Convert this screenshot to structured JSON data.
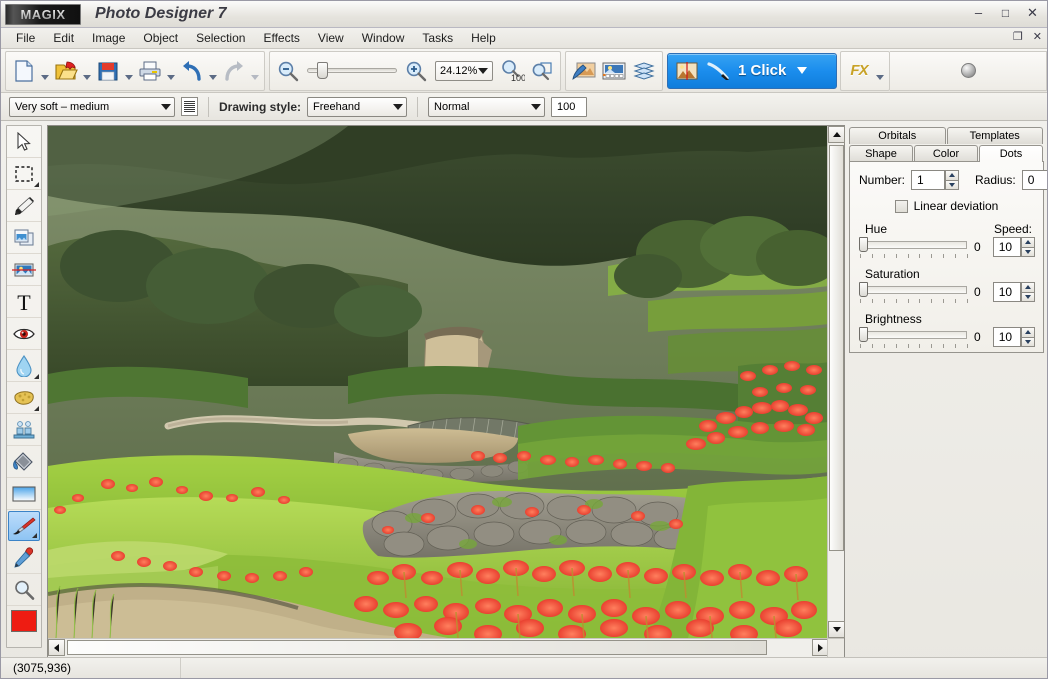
{
  "window": {
    "brand": "MAGIX",
    "title": "Photo Designer 7",
    "minimize_label": "–",
    "maximize_label": "□",
    "close_label": "✕",
    "doc_restore_label": "❐",
    "doc_close_label": "✕"
  },
  "menu": {
    "items": [
      {
        "label": "File"
      },
      {
        "label": "Edit"
      },
      {
        "label": "Image"
      },
      {
        "label": "Object"
      },
      {
        "label": "Selection"
      },
      {
        "label": "Effects"
      },
      {
        "label": "View"
      },
      {
        "label": "Window"
      },
      {
        "label": "Tasks"
      },
      {
        "label": "Help"
      }
    ]
  },
  "toolbar": {
    "file_group": [
      {
        "name": "new-document",
        "icon": "page-icon",
        "has_caret": true,
        "enabled": true
      },
      {
        "name": "open-document",
        "icon": "folder-open-icon",
        "has_caret": true,
        "enabled": true
      },
      {
        "name": "save-document",
        "icon": "floppy-disk-icon",
        "has_caret": true,
        "enabled": true
      },
      {
        "name": "print-document",
        "icon": "printer-icon",
        "has_caret": true,
        "enabled": true
      },
      {
        "name": "undo",
        "icon": "undo-arrow-icon",
        "has_caret": true,
        "enabled": true
      },
      {
        "name": "redo",
        "icon": "redo-arrow-icon",
        "has_caret": true,
        "enabled": false
      }
    ],
    "zoom_out_label": "Zoom out",
    "zoom_in_label": "Zoom in",
    "zoom_value": "24.12%",
    "zoom_100_label": "100",
    "zoom_fit_label": "Fit to window",
    "view_group": [
      {
        "name": "edit-mode",
        "icon": "brush-photo-icon"
      },
      {
        "name": "media-pool",
        "icon": "filmstrip-icon"
      },
      {
        "name": "layers",
        "icon": "layers-stack-icon"
      }
    ],
    "one_click_label": "1 Click",
    "fx_label": "FX",
    "help_icon_name": "globe-icon"
  },
  "options_bar": {
    "brush_preset": "Very soft – medium",
    "preset_list_icon": "list-view-icon",
    "drawing_style_label": "Drawing style:",
    "drawing_style_value": "Freehand",
    "blend_mode_value": "Normal",
    "opacity_value": "100"
  },
  "tools": [
    {
      "name": "tool-pointer",
      "icon": "arrow-cursor-icon",
      "corner": false,
      "active": false
    },
    {
      "name": "tool-select",
      "icon": "marquee-select-icon",
      "corner": true,
      "active": false
    },
    {
      "name": "tool-pencil",
      "icon": "pencil-icon",
      "corner": false,
      "active": false
    },
    {
      "name": "tool-clone",
      "icon": "clone-stamp-icon",
      "corner": false,
      "active": false
    },
    {
      "name": "tool-crop",
      "icon": "crop-image-icon",
      "corner": false,
      "active": false
    },
    {
      "name": "tool-text",
      "icon": "text-icon",
      "corner": false,
      "active": false
    },
    {
      "name": "tool-redeye",
      "icon": "red-eye-icon",
      "corner": false,
      "active": false
    },
    {
      "name": "tool-blur",
      "icon": "water-drop-icon",
      "corner": true,
      "active": false
    },
    {
      "name": "tool-sponge",
      "icon": "sponge-icon",
      "corner": true,
      "active": false
    },
    {
      "name": "tool-clone-figures",
      "icon": "figures-icon",
      "corner": false,
      "active": false
    },
    {
      "name": "tool-fill",
      "icon": "paint-bucket-icon",
      "corner": false,
      "active": false
    },
    {
      "name": "tool-gradient",
      "icon": "gradient-icon",
      "corner": false,
      "active": false
    },
    {
      "name": "tool-brush",
      "icon": "paint-brush-icon",
      "corner": true,
      "active": true
    },
    {
      "name": "tool-eyedropper",
      "icon": "eyedropper-icon",
      "corner": false,
      "active": false
    },
    {
      "name": "tool-zoom",
      "icon": "magnifier-icon",
      "corner": false,
      "active": false
    }
  ],
  "foreground_color": "#ee1c12",
  "canvas": {
    "image_description": "Japanese terraced rice fields in late summer with clusters of red spider lilies along stone retaining walls and footpaths, forested hillside behind",
    "scroll_vertical_name": "canvas-vertical-scrollbar",
    "scroll_horizontal_name": "canvas-horizontal-scrollbar"
  },
  "panel": {
    "tabs_top": [
      {
        "label": "Orbitals",
        "active": false
      },
      {
        "label": "Templates",
        "active": false
      }
    ],
    "tabs_bottom": [
      {
        "label": "Shape",
        "active": false
      },
      {
        "label": "Color",
        "active": false
      },
      {
        "label": "Dots",
        "active": true
      }
    ],
    "number_label": "Number:",
    "number_value": "1",
    "radius_label": "Radius:",
    "radius_value": "0",
    "linear_deviation_label": "Linear deviation",
    "linear_deviation_checked": false,
    "speed_label": "Speed:",
    "sliders": [
      {
        "label": "Hue",
        "value": "0",
        "speed": "10",
        "position_pct": 0
      },
      {
        "label": "Saturation",
        "value": "0",
        "speed": "10",
        "position_pct": 0
      },
      {
        "label": "Brightness",
        "value": "0",
        "speed": "10",
        "position_pct": 0
      }
    ]
  },
  "statusbar": {
    "coordinates": "(3075,936)"
  }
}
